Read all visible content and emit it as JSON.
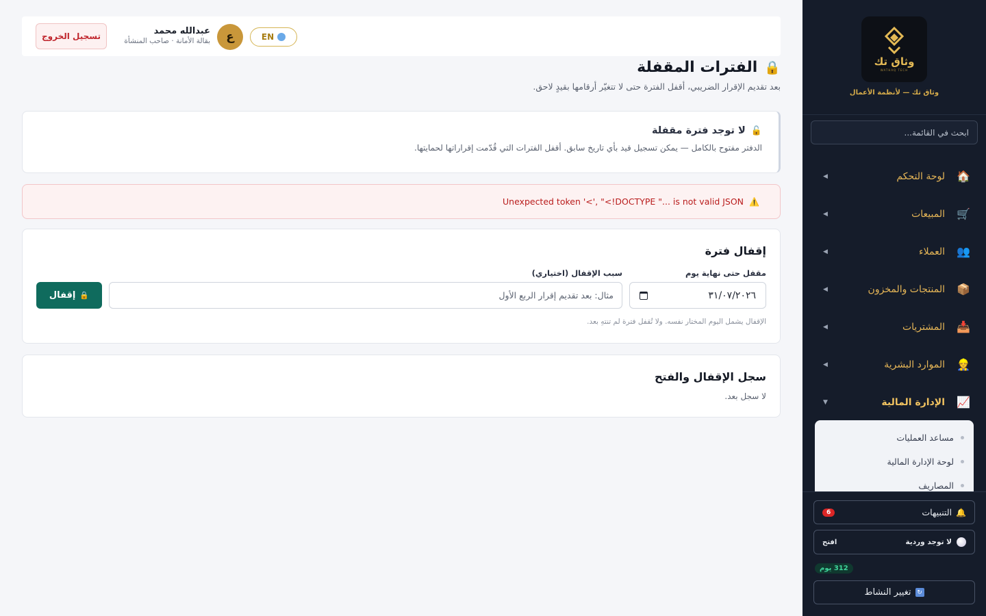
{
  "sidebar": {
    "logo_text": "وثاق تك",
    "logo_sub": "WATHAQ TECH",
    "brand_tagline": "وثاق تك — لأنظمة الأعمال",
    "search_placeholder": "ابحث في القائمة...",
    "nav_items": [
      {
        "label": "لوحة التحكم",
        "icon": "house-icon",
        "glyph": "🏠"
      },
      {
        "label": "المبيعات",
        "icon": "cart-icon",
        "glyph": "🛒"
      },
      {
        "label": "العملاء",
        "icon": "users-icon",
        "glyph": "👥"
      },
      {
        "label": "المنتجات والمخزون",
        "icon": "package-icon",
        "glyph": "📦"
      },
      {
        "label": "المشتريات",
        "icon": "inbox-icon",
        "glyph": "📥"
      },
      {
        "label": "الموارد البشرية",
        "icon": "person-icon",
        "glyph": "👷"
      },
      {
        "label": "الإدارة المالية",
        "icon": "chart-icon",
        "glyph": "📈"
      }
    ],
    "submenu": [
      "مساعد العمليات",
      "لوحة الإدارة المالية",
      "المصاريف"
    ],
    "alerts_label": "التنبيهات",
    "alerts_count": "6",
    "shift_label": "لا توجد وردية",
    "shift_open": "افتح",
    "days_badge": "312 يوم",
    "change_activity": "تغيير النشاط"
  },
  "topbar": {
    "lang": "EN",
    "avatar_letter": "ع",
    "user_name": "عبدالله محمد",
    "user_role": "بقالة الأمانة · صاحب المنشأة",
    "logout": "تسجيل الخروج"
  },
  "page": {
    "title": "الفترات المقفلة",
    "subtitle": "بعد تقديم الإقرار الضريبي، أقفل الفترة حتى لا تتغيّر أرقامها بقيدٍ لاحق."
  },
  "status_card": {
    "title": "لا توجد فترة مقفلة",
    "description": "الدفتر مفتوح بالكامل — يمكن تسجيل قيد بأي تاريخ سابق. أقفل الفترات التي قُدّمت إقراراتها لحمايتها."
  },
  "error_alert": "Unexpected token '<', \"<!DOCTYPE \"... is not valid JSON",
  "lock_form": {
    "title": "إقفال فترة",
    "date_label": "مقفل حتى نهاية يوم",
    "date_value": "٣١/٠٧/٢٠٢٦",
    "reason_label": "سبب الإقفال (اختياري)",
    "reason_placeholder": "مثال: بعد تقديم إقرار الربع الأول",
    "submit": "إقفال",
    "hint": "الإقفال يشمل اليوم المختار نفسه. ولا تُقفل فترة لم تنتهِ بعد."
  },
  "log_card": {
    "title": "سجل الإقفال والفتح",
    "empty": "لا سجل بعد."
  },
  "colors": {
    "sidebar_bg": "#151c2a",
    "accent_gold": "#e6b657",
    "primary_green": "#0f6b5d",
    "error_red": "#b91c1c"
  }
}
